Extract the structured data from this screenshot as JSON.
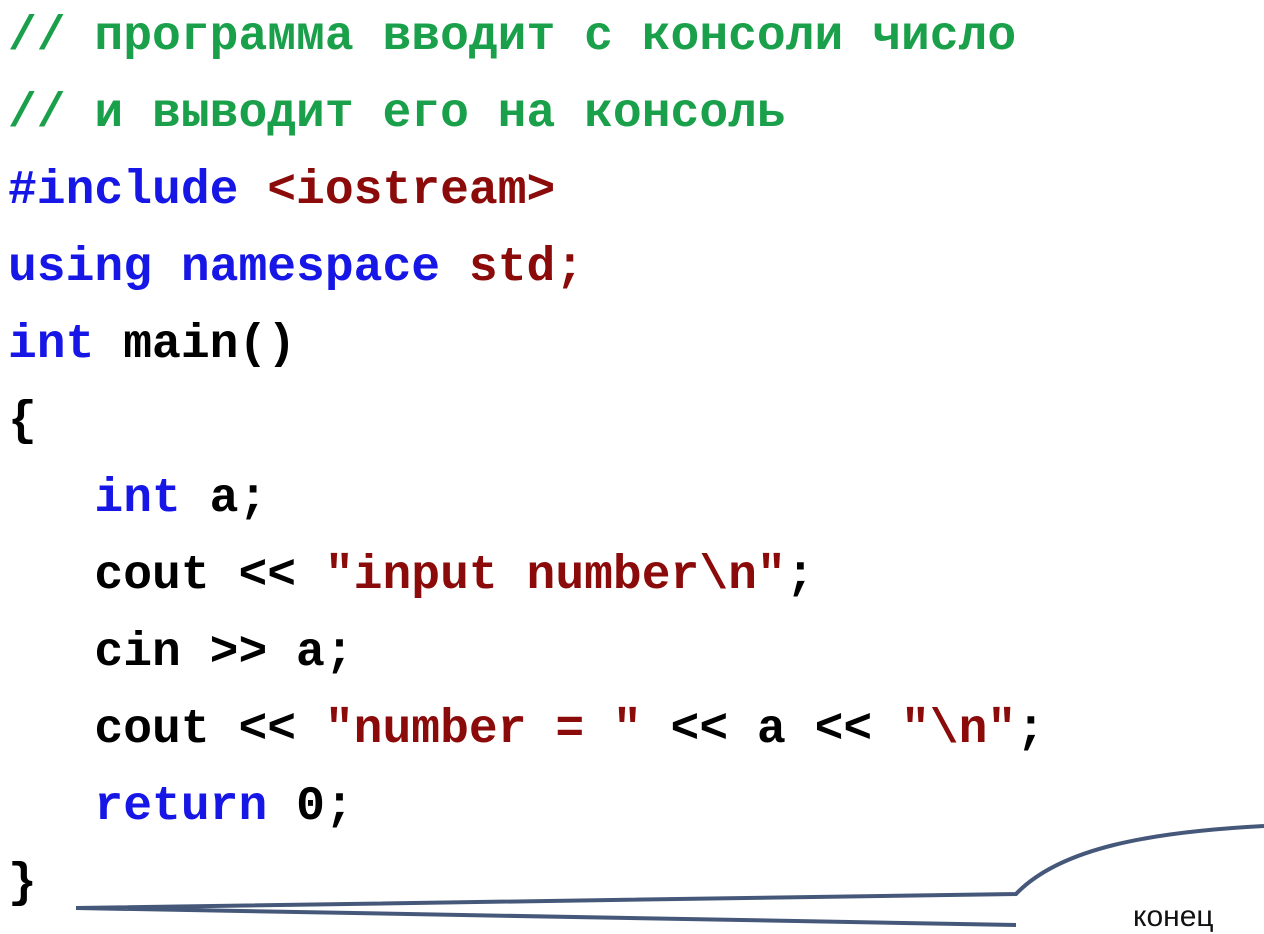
{
  "code": {
    "line1": {
      "comment": "// программа вводит с консоли число"
    },
    "line2": {
      "comment": "// и выводит его на консоль"
    },
    "line3": {
      "directive": "#include",
      "header": "<iostream>"
    },
    "line4": {
      "kw": "using namespace",
      "ns": "std;"
    },
    "line5": {
      "kw": "int",
      "rest": "main()"
    },
    "line6": {
      "brace": "{"
    },
    "line7": {
      "kw": "int",
      "rest": "a;"
    },
    "line8": {
      "pre": "cout <<",
      "str": "\"input number\\n\"",
      "post": ";"
    },
    "line9": {
      "text": "cin >> a;"
    },
    "line10": {
      "pre": "cout <<",
      "str1": "\"number = \"",
      "mid": "<< a <<",
      "str2": "\"\\n\"",
      "post": ";"
    },
    "line11": {
      "kw": "return",
      "rest": "0;"
    },
    "line12": {
      "brace": "}"
    }
  },
  "callout": {
    "text": "конец"
  },
  "colors": {
    "comment": "#1aa04a",
    "keyword": "#1616e6",
    "string": "#8b0a0a",
    "text": "#000000",
    "callout_line": "#46587a"
  }
}
